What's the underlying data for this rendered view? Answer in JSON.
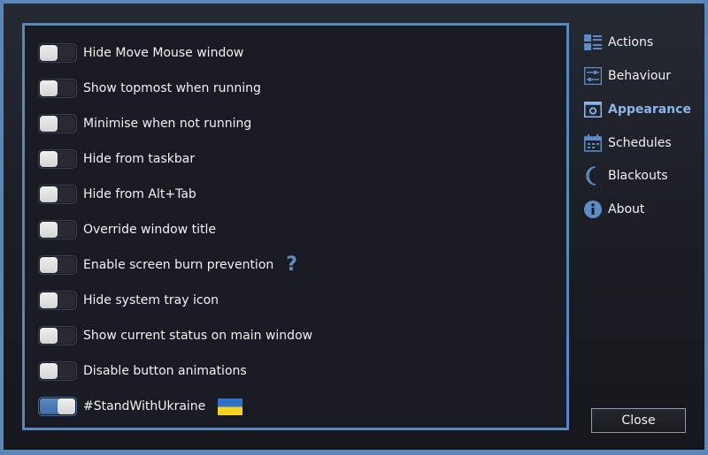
{
  "options": [
    {
      "label": "Hide Move Mouse window",
      "enabled": false
    },
    {
      "label": "Show topmost when running",
      "enabled": false
    },
    {
      "label": "Minimise when not running",
      "enabled": false
    },
    {
      "label": "Hide from taskbar",
      "enabled": false
    },
    {
      "label": "Hide from Alt+Tab",
      "enabled": false
    },
    {
      "label": "Override window title",
      "enabled": false
    },
    {
      "label": "Enable screen burn prevention",
      "enabled": false,
      "help": "?"
    },
    {
      "label": "Hide system tray icon",
      "enabled": false
    },
    {
      "label": "Show current status on main window",
      "enabled": false
    },
    {
      "label": "Disable button animations",
      "enabled": false
    },
    {
      "label": "#StandWithUkraine",
      "enabled": true,
      "flag_icon": "ukraine-flag-icon"
    }
  ],
  "nav": [
    {
      "label": "Actions",
      "icon": "actions-icon"
    },
    {
      "label": "Behaviour",
      "icon": "sliders-icon"
    },
    {
      "label": "Appearance",
      "icon": "appearance-icon",
      "active": true
    },
    {
      "label": "Schedules",
      "icon": "calendar-icon"
    },
    {
      "label": "Blackouts",
      "icon": "moon-icon"
    },
    {
      "label": "About",
      "icon": "info-icon"
    }
  ],
  "close_label": "Close",
  "colors": {
    "accent": "#5a87bf",
    "active_nav": "#8db5ea",
    "toggle_on": "#4d7fbe",
    "flag_blue": "#2f70c9",
    "flag_yellow": "#f4d21e"
  }
}
